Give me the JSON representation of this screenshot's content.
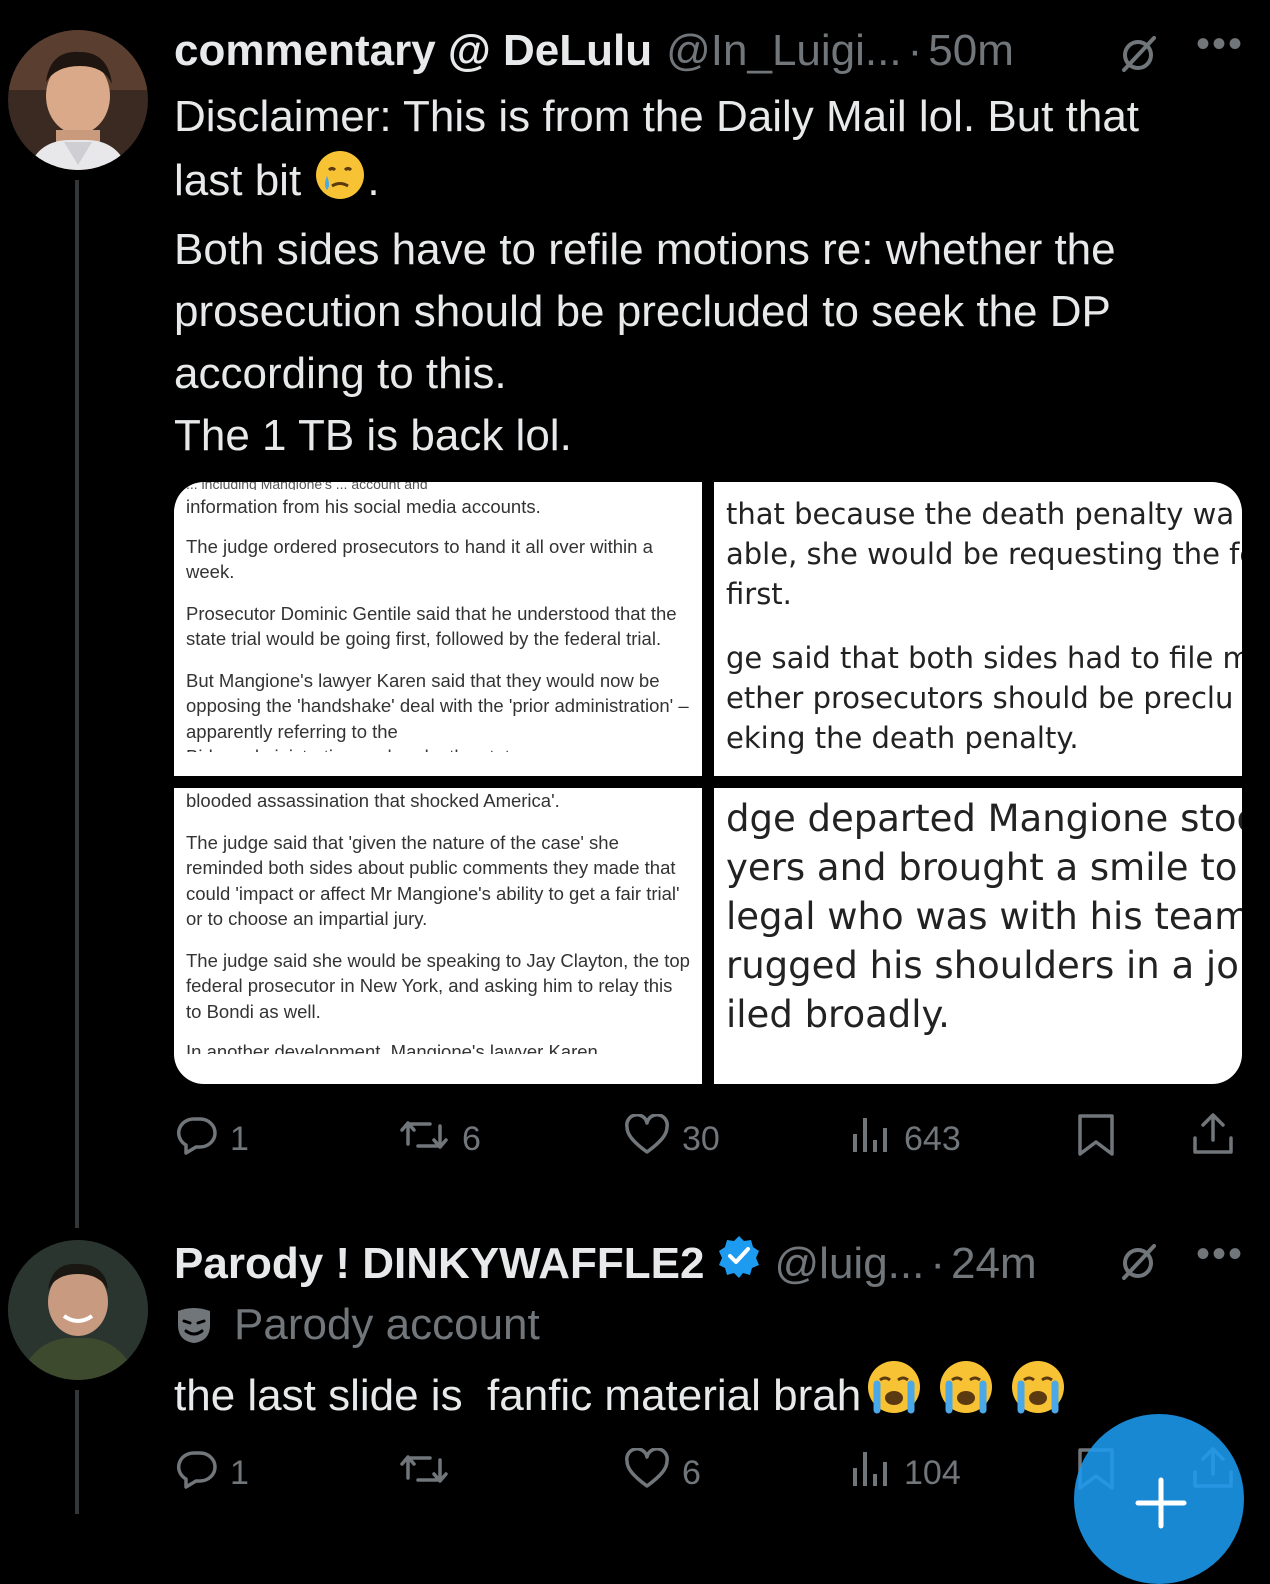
{
  "post1": {
    "display_name": "commentary @ DeLulu",
    "handle": "@In_Luigi...",
    "separator": "·",
    "time": "50m",
    "lines": [
      "Disclaimer: This is from the Daily Mail lol. But that",
      "last bit",
      "Both sides have to refile motions re: whether the",
      "prosecution should be precluded to seek the DP",
      "according to this.",
      "The 1 TB is back lol."
    ],
    "line2_suffix": ".",
    "media": {
      "top_left": {
        "cut_top": "... including Mangione's ... account and",
        "paragraphs": [
          "information from his social media accounts.",
          "The judge ordered prosecutors to hand it all over within a week.",
          "Prosecutor Dominic Gentile said that he understood that the state trial would be going first, followed by the federal trial.",
          "But Mangione's lawyer Karen said that they would now be opposing the 'handshake' deal with the 'prior administration' – apparently referring to the"
        ],
        "cut_bottom": "Biden administration – whereby the state case was"
      },
      "top_right": {
        "lines": [
          "that because the death penalty wa",
          "able, she would be requesting the fe",
          "first.",
          "ge said that both sides had to file mo",
          "ether prosecutors should be preclu",
          "eking the death penalty."
        ]
      },
      "bottom_left": {
        "paragraphs": [
          "blooded assassination that shocked America'.",
          "The judge said that 'given the nature of the case' she reminded both sides about public comments they made that could 'impact or affect Mr Mangione's ability to get a fair trial' or to choose an impartial jury.",
          "The judge said she would be speaking to Jay Clayton, the top federal prosecutor in New York, and asking him to relay this to Bondi as well."
        ],
        "cut_bottom": "In another development, Mangione's lawyer Karen"
      },
      "bottom_right": {
        "lines": [
          "dge departed Mangione stoo",
          "yers and brought a smile to f",
          "legal who was with his team",
          "rugged his shoulders in a joki",
          "iled broadly."
        ]
      }
    },
    "stats": {
      "replies": "1",
      "reposts": "6",
      "likes": "30",
      "views": "643"
    }
  },
  "post2": {
    "display_name": "Parody ! DINKYWAFFLE2",
    "handle": "@luig...",
    "separator": "·",
    "time": "24m",
    "label": "Parody account",
    "text": "the last slide is  fanfic material brah",
    "stats": {
      "replies": "1",
      "reposts": "",
      "likes": "6",
      "views": "104"
    }
  },
  "colors": {
    "background": "#000000",
    "text": "#e7e9ea",
    "muted": "#71767b",
    "verified": "#1d9bf0",
    "fab": "#1d9bf0"
  },
  "icons": [
    "reply-icon",
    "repost-icon",
    "like-icon",
    "views-icon",
    "bookmark-icon",
    "share-icon",
    "grok-icon",
    "more-icon",
    "verified-icon",
    "parody-mask-icon",
    "compose-icon"
  ]
}
